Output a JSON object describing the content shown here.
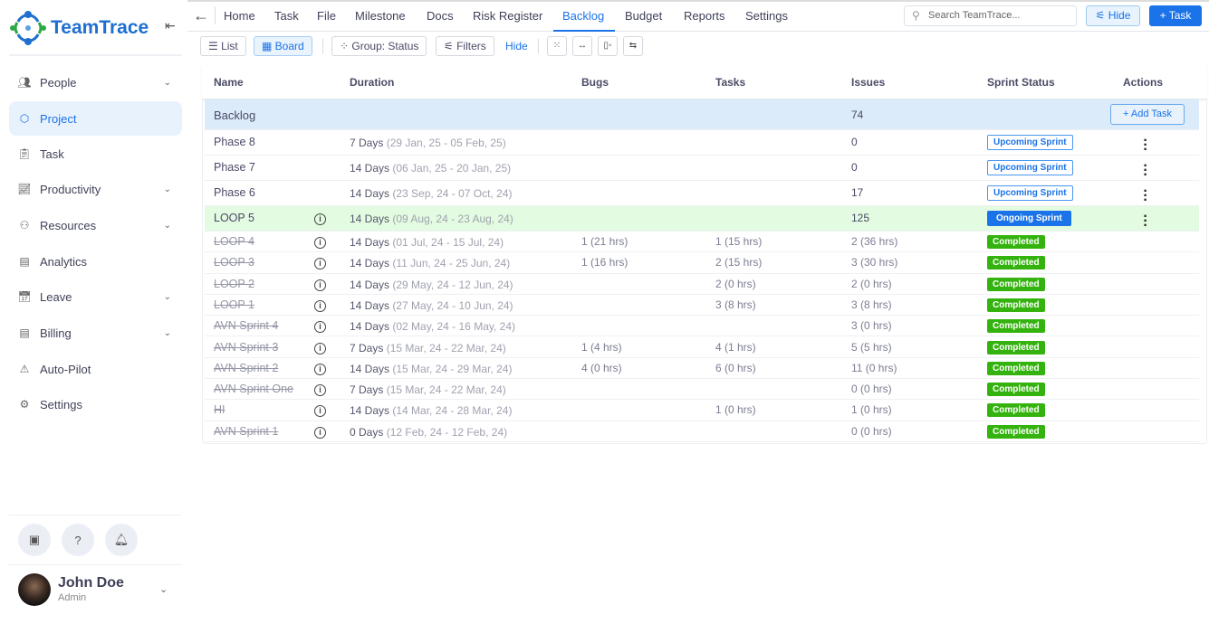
{
  "app": {
    "name": "TeamTrace"
  },
  "sidebar": {
    "items": [
      {
        "label": "People",
        "icon": "people-icon",
        "chev": true
      },
      {
        "label": "Project",
        "icon": "cube-icon",
        "active": true
      },
      {
        "label": "Task",
        "icon": "clipboard-icon"
      },
      {
        "label": "Productivity",
        "icon": "chart-line-icon",
        "chev": true
      },
      {
        "label": "Resources",
        "icon": "resources-icon",
        "chev": true
      },
      {
        "label": "Analytics",
        "icon": "document-chart-icon"
      },
      {
        "label": "Leave",
        "icon": "calendar-icon",
        "chev": true
      },
      {
        "label": "Billing",
        "icon": "billing-icon",
        "chev": true
      },
      {
        "label": "Auto-Pilot",
        "icon": "warning-triangle-icon"
      },
      {
        "label": "Settings",
        "icon": "gear-icon"
      }
    ],
    "user": {
      "name": "John Doe",
      "role": "Admin"
    }
  },
  "nav": {
    "tabs": [
      "Home",
      "Task",
      "File",
      "Milestone",
      "Docs",
      "Risk Register",
      "Backlog",
      "Budget",
      "Reports",
      "Settings"
    ],
    "active": "Backlog",
    "search_placeholder": "Search TeamTrace...",
    "hide_label": "Hide",
    "task_label": "+ Task"
  },
  "toolbar": {
    "list": "List",
    "board": "Board",
    "group": "Group: Status",
    "filters": "Filters",
    "hide": "Hide"
  },
  "table": {
    "headers": [
      "Name",
      "Duration",
      "Bugs",
      "Tasks",
      "Issues",
      "Sprint Status",
      "Actions"
    ],
    "backlog": {
      "name": "Backlog",
      "issues": "74",
      "add_task": "+ Add Task"
    },
    "rows": [
      {
        "name": "Phase 8",
        "days": "7 Days",
        "range": "(29 Jan, 25 - 05 Feb, 25)",
        "bugs": "",
        "tasks": "",
        "issues": "0",
        "status": "Upcoming Sprint",
        "type": "up"
      },
      {
        "name": "Phase 7",
        "days": "14 Days",
        "range": "(06 Jan, 25 - 20 Jan, 25)",
        "bugs": "",
        "tasks": "",
        "issues": "0",
        "status": "Upcoming Sprint",
        "type": "up"
      },
      {
        "name": "Phase 6",
        "days": "14 Days",
        "range": "(23 Sep, 24 - 07 Oct, 24)",
        "bugs": "",
        "tasks": "",
        "issues": "17",
        "status": "Upcoming Sprint",
        "type": "up"
      },
      {
        "name": "LOOP 5",
        "days": "14 Days",
        "range": "(09 Aug, 24 - 23 Aug, 24)",
        "bugs": "",
        "tasks": "",
        "issues": "125",
        "status": "Ongoing Sprint",
        "type": "on"
      },
      {
        "name": "LOOP 4",
        "days": "14 Days",
        "range": "(01 Jul, 24 - 15 Jul, 24)",
        "bugs": "1 (21 hrs)",
        "tasks": "1 (15 hrs)",
        "issues": "2 (36 hrs)",
        "status": "Completed",
        "type": "done"
      },
      {
        "name": "LOOP 3",
        "days": "14 Days",
        "range": "(11 Jun, 24 - 25 Jun, 24)",
        "bugs": "1 (16 hrs)",
        "tasks": "2 (15 hrs)",
        "issues": "3 (30 hrs)",
        "status": "Completed",
        "type": "done"
      },
      {
        "name": "LOOP 2",
        "days": "14 Days",
        "range": "(29 May, 24 - 12 Jun, 24)",
        "bugs": "",
        "tasks": "2 (0 hrs)",
        "issues": "2 (0 hrs)",
        "status": "Completed",
        "type": "done"
      },
      {
        "name": "LOOP 1",
        "days": "14 Days",
        "range": "(27 May, 24 - 10 Jun, 24)",
        "bugs": "",
        "tasks": "3 (8 hrs)",
        "issues": "3 (8 hrs)",
        "status": "Completed",
        "type": "done"
      },
      {
        "name": "AVN Sprint 4",
        "days": "14 Days",
        "range": "(02 May, 24 - 16 May, 24)",
        "bugs": "",
        "tasks": "",
        "issues": "3 (0 hrs)",
        "status": "Completed",
        "type": "done"
      },
      {
        "name": "AVN Sprint 3",
        "days": "7 Days",
        "range": "(15 Mar, 24 - 22 Mar, 24)",
        "bugs": "1 (4 hrs)",
        "tasks": "4 (1 hrs)",
        "issues": "5 (5 hrs)",
        "status": "Completed",
        "type": "done"
      },
      {
        "name": "AVN Sprint 2",
        "days": "14 Days",
        "range": "(15 Mar, 24 - 29 Mar, 24)",
        "bugs": "4 (0 hrs)",
        "tasks": "6 (0 hrs)",
        "issues": "11 (0 hrs)",
        "status": "Completed",
        "type": "done"
      },
      {
        "name": "AVN Sprint One",
        "days": "7 Days",
        "range": "(15 Mar, 24 - 22 Mar, 24)",
        "bugs": "",
        "tasks": "",
        "issues": "0 (0 hrs)",
        "status": "Completed",
        "type": "done"
      },
      {
        "name": "HI",
        "days": "14 Days",
        "range": "(14 Mar, 24 - 28 Mar, 24)",
        "bugs": "",
        "tasks": "1 (0 hrs)",
        "issues": "1 (0 hrs)",
        "status": "Completed",
        "type": "done"
      },
      {
        "name": "AVN Sprint 1",
        "days": "0 Days",
        "range": "(12 Feb, 24 - 12 Feb, 24)",
        "bugs": "",
        "tasks": "",
        "issues": "0 (0 hrs)",
        "status": "Completed",
        "type": "done"
      }
    ]
  },
  "colors": {
    "accent": "#1a73e8",
    "completed": "#34b30f",
    "backlog_row": "#dcebfa",
    "ongoing_row": "#e3fbe0"
  }
}
